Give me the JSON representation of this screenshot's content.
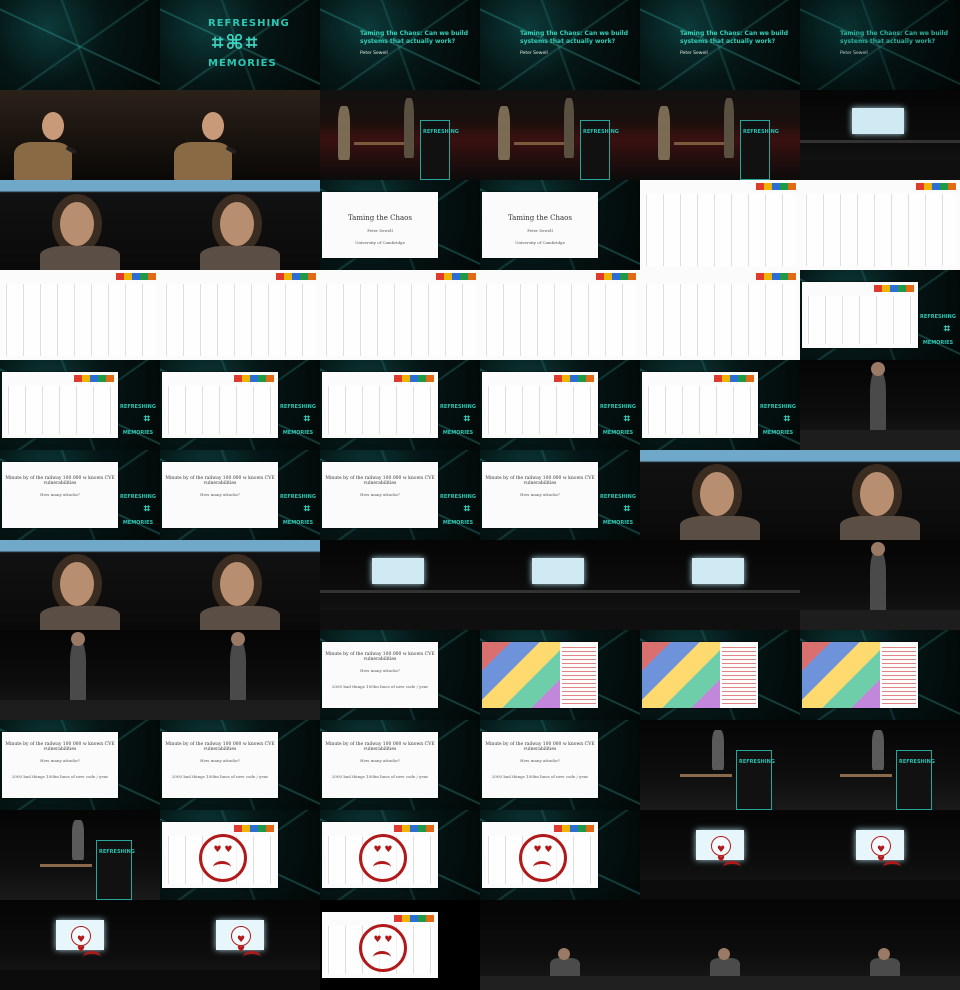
{
  "grid": {
    "columns": 6,
    "rows": 11
  },
  "branding": {
    "top": "REFRESHING",
    "bottom": "MEMORIES"
  },
  "talk": {
    "title": "Taming the Chaos: Can we build systems that actually work?",
    "speaker": "Peter Sewell"
  },
  "slides": {
    "title_big": "Taming the Chaos",
    "title_author": "Peter Sewell",
    "title_affil": "University of Cambridge",
    "cats_line1": "Minute by of the railway 100 000 w known CVE vulnerabilities",
    "cats_line2": "How many attacks?",
    "cats_line3": "2000 bad things 100bn lines of new code / year"
  }
}
